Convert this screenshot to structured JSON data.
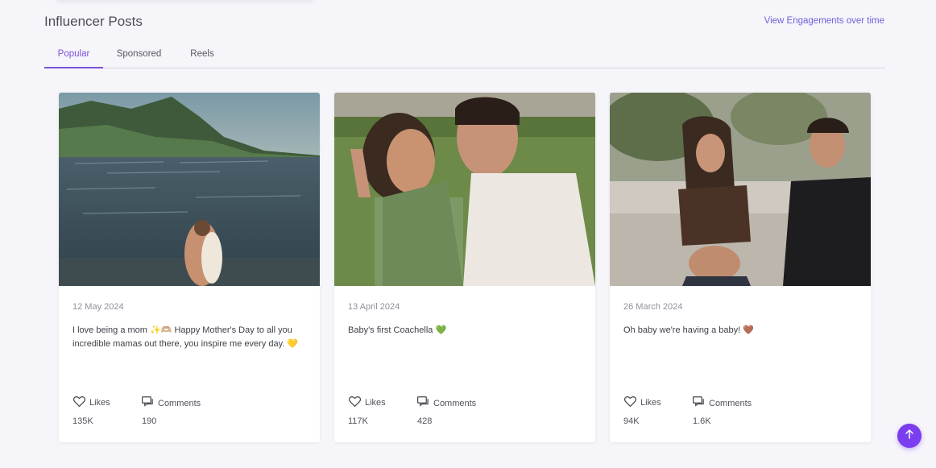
{
  "header": {
    "title": "Influencer Posts",
    "view_link": "View Engagements over time"
  },
  "tabs": [
    {
      "label": "Popular",
      "active": true
    },
    {
      "label": "Sponsored",
      "active": false
    },
    {
      "label": "Reels",
      "active": false
    }
  ],
  "posts": [
    {
      "date": "12 May 2024",
      "caption": "I love being a mom ✨🫶🏼 Happy Mother's Day to all you incredible mamas out there, you inspire me every day. 💛",
      "likes_label": "Likes",
      "likes": "135K",
      "comments_label": "Comments",
      "comments": "190"
    },
    {
      "date": "13 April 2024",
      "caption": "Baby's first Coachella 💚",
      "likes_label": "Likes",
      "likes": "117K",
      "comments_label": "Comments",
      "comments": "428"
    },
    {
      "date": "26 March 2024",
      "caption": "Oh baby we're having a baby! 🤎",
      "likes_label": "Likes",
      "likes": "94K",
      "comments_label": "Comments",
      "comments": "1.6K"
    }
  ],
  "icons": {
    "likes": "heart-icon",
    "comments": "comments-icon",
    "scroll_top": "arrow-up-icon"
  },
  "colors": {
    "accent": "#7a52d8",
    "link": "#6b63d8",
    "scroll_button": "#7a3ef0",
    "background": "#f6f5fa"
  }
}
